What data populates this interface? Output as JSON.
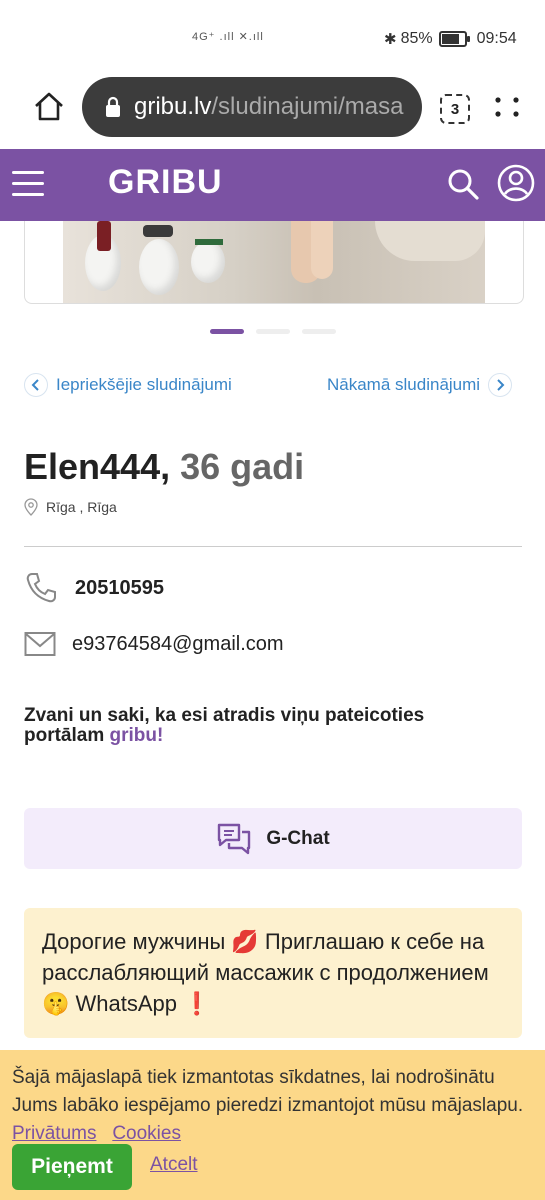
{
  "status_bar": {
    "network": "4G⁺ .ıll ✕.ıll",
    "battery": "85%",
    "battery_level": 0.85,
    "time": "09:54"
  },
  "browser": {
    "url_host": "gribu.lv",
    "url_path": "/sludinajumi/masa",
    "tab_count": "3"
  },
  "header": {
    "logo": "GRIBU"
  },
  "gallery": {
    "active_dot": 0,
    "dot_count": 3
  },
  "navigation": {
    "prev_label": "Iepriekšējie sludinājumi",
    "next_label": "Nākamā sludinājumi"
  },
  "profile": {
    "name": "Elen444,",
    "age": "36 gadi",
    "location": "Rīga ,  Rīga",
    "phone": "20510595",
    "email": "e93764584@gmail.com"
  },
  "hint": {
    "text": "Zvani un saki, ka esi atradis viņu pateicoties portālam ",
    "brand": "gribu!"
  },
  "gchat": {
    "label": "G-Chat"
  },
  "description": {
    "text": "Дорогие мужчины 💋 Приглашаю к себе на расслабляющий массажик с продолжением 🤫 WhatsApp ❗"
  },
  "cookie_bar": {
    "text": "Šajā mājaslapā tiek izmantotas sīkdatnes, lai nodrošinātu Jums labāko iespējamo pieredzi izmantojot mūsu mājaslapu.",
    "privacy_link": "Privātums",
    "cookies_link": "Cookies",
    "accept_label": "Pieņemt",
    "decline_label": "Atcelt"
  },
  "colors": {
    "brand_purple": "#7b52a3",
    "link_blue": "#3a86c8",
    "accept_green": "#3aa435",
    "cookie_bg": "#fcd889",
    "desc_bg": "#fdf1cf",
    "gchat_bg": "#f3ecfb"
  }
}
